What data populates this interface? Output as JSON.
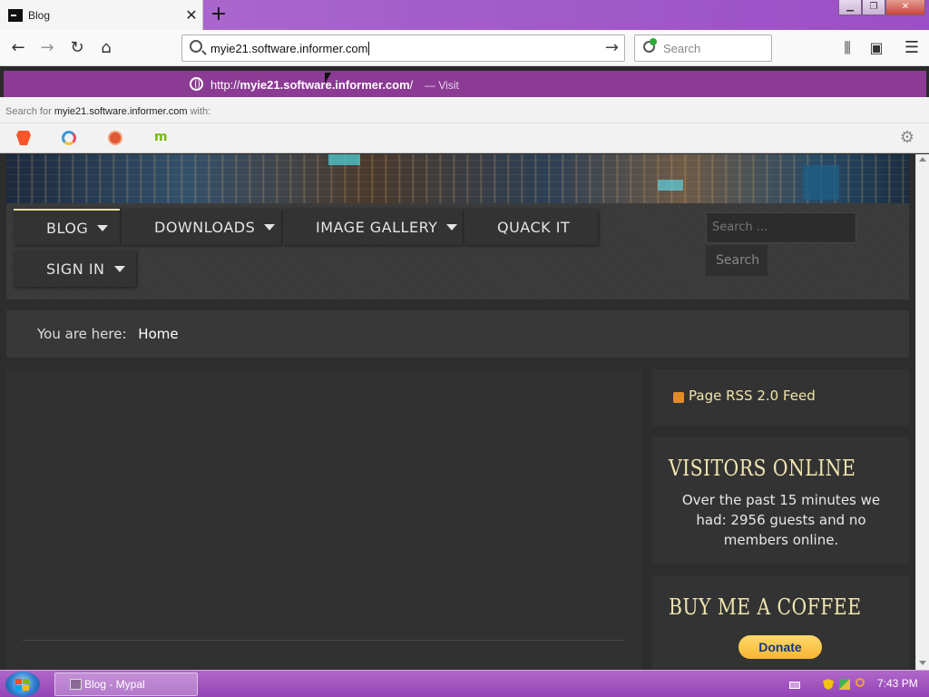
{
  "browser": {
    "tab_title": "Blog",
    "tab_close": "✕",
    "new_tab": "+",
    "url": "myie21.software.informer.com",
    "search_placeholder": "Search",
    "suggestion": {
      "prefix": "http://",
      "url_bold": "myie21.software.informer.com",
      "suffix": "/",
      "action": "— Visit"
    },
    "search_for_prefix": "Search for",
    "search_for_term": "myie21.software.informer.com",
    "search_for_suffix": "with:",
    "engines": [
      "brave",
      "qwant",
      "duckduckgo",
      "mojeek"
    ],
    "window_buttons": [
      "minimize",
      "restore",
      "close"
    ]
  },
  "site": {
    "menu": [
      {
        "label": "BLOG",
        "has_dropdown": true,
        "active": true
      },
      {
        "label": "DOWNLOADS",
        "has_dropdown": true,
        "active": false
      },
      {
        "label": "IMAGE GALLERY",
        "has_dropdown": true,
        "active": false
      },
      {
        "label": "QUACK IT",
        "has_dropdown": false,
        "active": false
      },
      {
        "label": "SIGN IN",
        "has_dropdown": true,
        "active": false
      }
    ],
    "search_placeholder": "Search ...",
    "search_button": "Search",
    "breadcrumb_prefix": "You are here:",
    "breadcrumb_current": "Home",
    "rss_label": "Page RSS 2.0 Feed",
    "visitors_title": "VISITORS ONLINE",
    "visitors_text": "Over the past 15 minutes we had: 2956 guests and no members online.",
    "coffee_title": "BUY ME A COFFEE",
    "donate_label": "Donate"
  },
  "taskbar": {
    "task_label": "Blog - Mypal",
    "clock": "7:43 PM"
  },
  "colors": {
    "accent_purple": "#9b4fc6",
    "suggestion_bg": "#8b3b93",
    "heading_cream": "#f0e6b0",
    "page_bg": "#2d2d2d"
  }
}
